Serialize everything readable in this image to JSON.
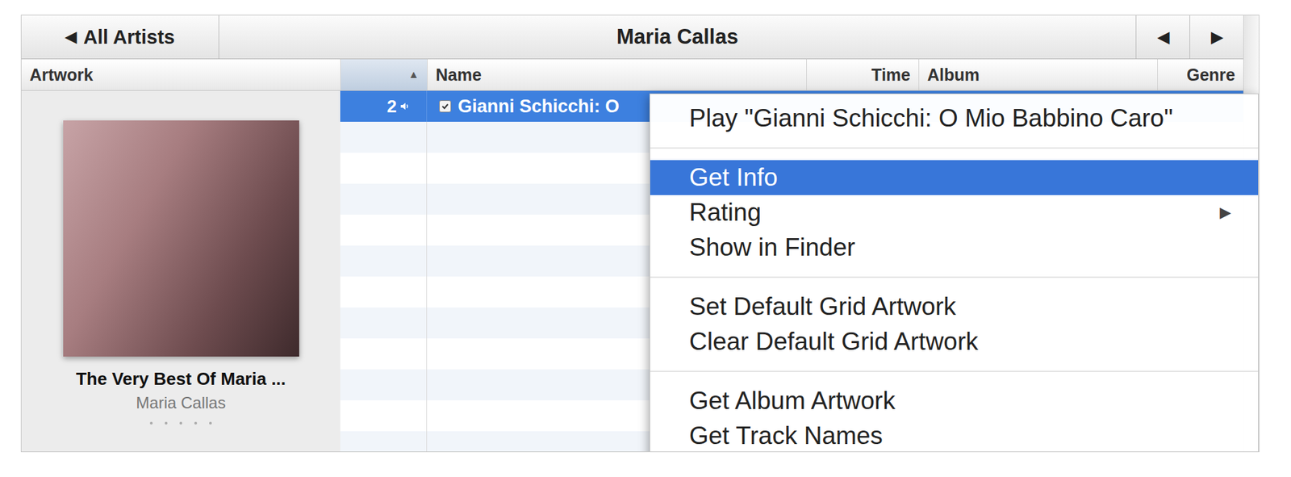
{
  "toolbar": {
    "back_icon": "◀",
    "back_label": "All Artists",
    "title": "Maria Callas",
    "nav": [
      {
        "icon": "◀"
      },
      {
        "icon": "▶"
      }
    ]
  },
  "columns": [
    {
      "label": "Artwork",
      "sorted": false
    },
    {
      "label": "▲",
      "sorted": true
    },
    {
      "label": "Name",
      "sorted": false
    },
    {
      "label": "Time",
      "sorted": false
    },
    {
      "label": "Album",
      "sorted": false
    },
    {
      "label": "Genre",
      "sorted": false
    }
  ],
  "album": {
    "title": "The Very Best Of Maria ...",
    "artist": "Maria Callas",
    "stars": 0
  },
  "tracks": [
    {
      "number": "2",
      "playing": true,
      "checked": true,
      "name": "Gianni Schicchi: O",
      "selected": true
    }
  ],
  "context_menu": {
    "items": [
      {
        "kind": "item",
        "label": "Play \"Gianni Schicchi: O Mio Babbino Caro\"",
        "selected": false
      },
      {
        "kind": "separator"
      },
      {
        "kind": "item",
        "label": "Get Info",
        "selected": true
      },
      {
        "kind": "item",
        "label": "Rating",
        "selected": false,
        "submenu_icon": "▶"
      },
      {
        "kind": "item",
        "label": "Show in Finder",
        "selected": false
      },
      {
        "kind": "separator"
      },
      {
        "kind": "item",
        "label": "Set Default Grid Artwork",
        "selected": false
      },
      {
        "kind": "item",
        "label": "Clear Default Grid Artwork",
        "selected": false
      },
      {
        "kind": "separator"
      },
      {
        "kind": "item",
        "label": "Get Album Artwork",
        "selected": false
      },
      {
        "kind": "item",
        "label": "Get Track Names",
        "selected": false
      }
    ]
  }
}
